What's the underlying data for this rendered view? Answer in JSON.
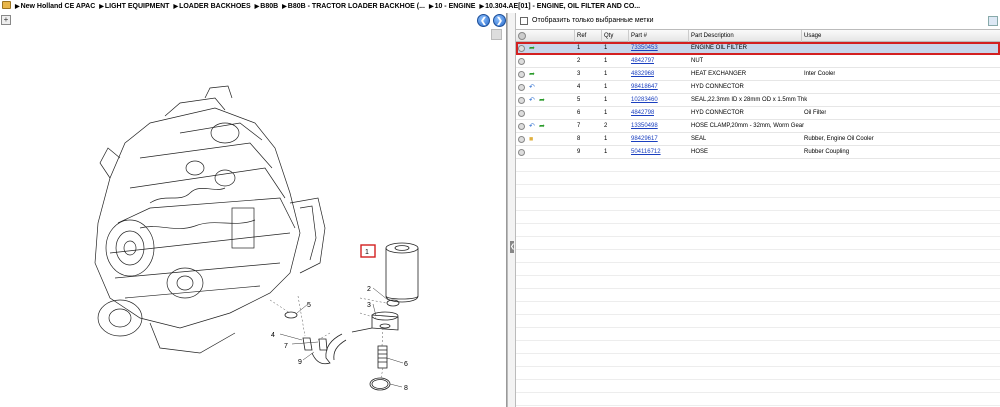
{
  "breadcrumb": [
    "New Holland CE APAC",
    "LIGHT EQUIPMENT",
    "LOADER BACKHOES",
    "B80B",
    "B80B - TRACTOR LOADER BACKHOE (...",
    "10 - ENGINE",
    "10.304.AE[01] - ENGINE, OIL FILTER AND CO..."
  ],
  "left": {
    "zoom_symbol": "+",
    "back_symbol": "❮",
    "forward_symbol": "❯"
  },
  "callouts": [
    "1",
    "2",
    "3",
    "4",
    "5",
    "6",
    "7",
    "8",
    "9"
  ],
  "filter": {
    "label": "Отобразить только выбранные метки"
  },
  "grid": {
    "columns": [
      "Ref",
      "Qty",
      "Part #",
      "Part Description",
      "Usage"
    ],
    "rows": [
      {
        "ref": "1",
        "qty": "1",
        "part": "73350453",
        "desc": "ENGINE OIL FILTER",
        "usage": "",
        "icons": [
          "green-arrow"
        ]
      },
      {
        "ref": "2",
        "qty": "1",
        "part": "4842797",
        "desc": "NUT",
        "usage": "",
        "icons": []
      },
      {
        "ref": "3",
        "qty": "1",
        "part": "4832968",
        "desc": "HEAT EXCHANGER",
        "usage": "Inter Cooler",
        "icons": [
          "green-arrow"
        ]
      },
      {
        "ref": "4",
        "qty": "1",
        "part": "98418647",
        "desc": "HYD CONNECTOR",
        "usage": "",
        "icons": [
          "blue-arrow"
        ]
      },
      {
        "ref": "5",
        "qty": "1",
        "part": "10283460",
        "desc": "SEAL,22.3mm ID x 28mm OD x 1.5mm Thk",
        "usage": "",
        "icons": [
          "blue-arrow",
          "green-arrow"
        ]
      },
      {
        "ref": "6",
        "qty": "1",
        "part": "4842798",
        "desc": "HYD CONNECTOR",
        "usage": "Oil Filter",
        "icons": []
      },
      {
        "ref": "7",
        "qty": "2",
        "part": "13350498",
        "desc": "HOSE CLAMP,20mm - 32mm, Worm Gear",
        "usage": "",
        "icons": [
          "blue-arrow",
          "green-arrow"
        ]
      },
      {
        "ref": "8",
        "qty": "1",
        "part": "98429617",
        "desc": "SEAL",
        "usage": "Rubber, Engine Oil Cooler",
        "icons": [
          "box"
        ]
      },
      {
        "ref": "9",
        "qty": "1",
        "part": "504116712",
        "desc": "HOSE",
        "usage": "Rubber Coupling",
        "icons": []
      }
    ]
  },
  "colors": {
    "selection_bg": "#c8d6ea",
    "selection_border": "#d32020",
    "link": "#1a3fbf"
  }
}
